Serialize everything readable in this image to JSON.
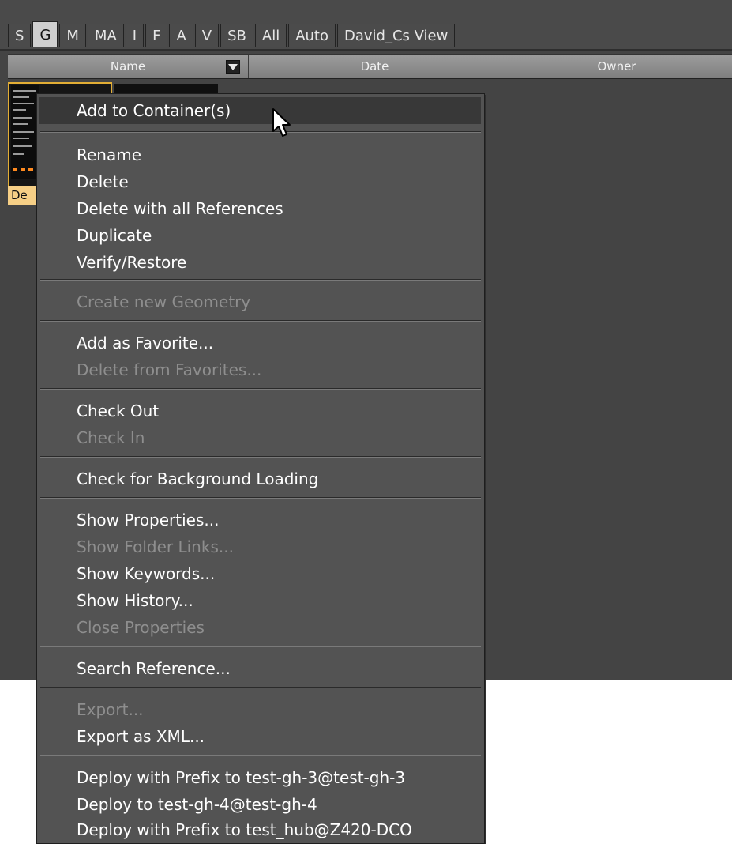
{
  "tabs": [
    {
      "label": "S",
      "active": false
    },
    {
      "label": "G",
      "active": true
    },
    {
      "label": "M",
      "active": false
    },
    {
      "label": "MA",
      "active": false
    },
    {
      "label": "I",
      "active": false
    },
    {
      "label": "F",
      "active": false
    },
    {
      "label": "A",
      "active": false
    },
    {
      "label": "V",
      "active": false
    },
    {
      "label": "SB",
      "active": false
    },
    {
      "label": "All",
      "active": false
    },
    {
      "label": "Auto",
      "active": false
    },
    {
      "label": "David_Cs View",
      "active": false
    }
  ],
  "columns": {
    "name": "Name",
    "date": "Date",
    "owner": "Owner"
  },
  "sort_icon": "dropdown-arrow-icon",
  "file_item": {
    "label": "De"
  },
  "context_menu": {
    "items": {
      "add_to_container": "Add to Container(s)",
      "rename": "Rename",
      "delete": "Delete",
      "delete_all_refs": "Delete with all References",
      "duplicate": "Duplicate",
      "verify_restore": "Verify/Restore",
      "create_geometry": "Create new Geometry",
      "add_favorite": "Add as Favorite...",
      "delete_favorites": "Delete from Favorites...",
      "check_out": "Check Out",
      "check_in": "Check In",
      "check_bg_loading": "Check for Background Loading",
      "show_properties": "Show Properties...",
      "show_folder_links": "Show Folder Links...",
      "show_keywords": "Show Keywords...",
      "show_history": "Show History...",
      "close_properties": "Close Properties",
      "search_reference": "Search Reference...",
      "export": "Export...",
      "export_xml": "Export as XML...",
      "deploy_prefix_gh3": "Deploy with Prefix to test-gh-3@test-gh-3",
      "deploy_gh4": "Deploy to test-gh-4@test-gh-4",
      "deploy_prefix_hub": "Deploy with Prefix to test_hub@Z420-DCO"
    }
  },
  "colors": {
    "panel_bg": "#444444",
    "menu_bg": "#535353",
    "selection_border": "#e3ae35",
    "label_bg": "#f6cf86"
  }
}
